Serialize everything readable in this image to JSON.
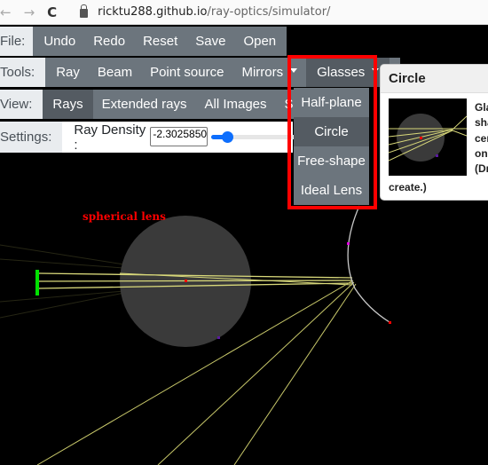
{
  "browser": {
    "back_icon": "←",
    "forward_icon": "→",
    "reload_icon": "C",
    "url_host": "ricktu288.github.io",
    "url_path": "/ray-optics/simulator/"
  },
  "file_bar": {
    "label": "File:",
    "buttons": [
      "Undo",
      "Redo",
      "Reset",
      "Save",
      "Open"
    ]
  },
  "tools_bar": {
    "label": "Tools:",
    "buttons": [
      "Ray",
      "Beam",
      "Point source",
      "Mirrors",
      "Glasses"
    ]
  },
  "view_bar": {
    "label": "View:",
    "buttons": [
      "Rays",
      "Extended rays",
      "All Images",
      "See"
    ],
    "active": "Rays"
  },
  "settings_bar": {
    "label": "Settings:",
    "ray_density_label": "Ray Density :",
    "ray_density_value": "-2.3025850",
    "slider_fraction": 0.18
  },
  "glasses_menu": {
    "items": [
      "Half-plane",
      "Circle",
      "Free-shape",
      "Ideal Lens"
    ],
    "hovered": "Circle"
  },
  "popover": {
    "title": "Circle",
    "desc_lines": [
      "Gla",
      "sha",
      "cen",
      "on",
      "(Dr"
    ],
    "desc_tail": "create.)"
  },
  "canvas": {
    "annotation": "spherical lens",
    "colors": {
      "background": "#000000",
      "ray": "#d8d87a",
      "glass": "#3a3a3a",
      "source": "#00e000",
      "mirror": "#c8c8c8",
      "highlight": "#ff0000"
    }
  }
}
